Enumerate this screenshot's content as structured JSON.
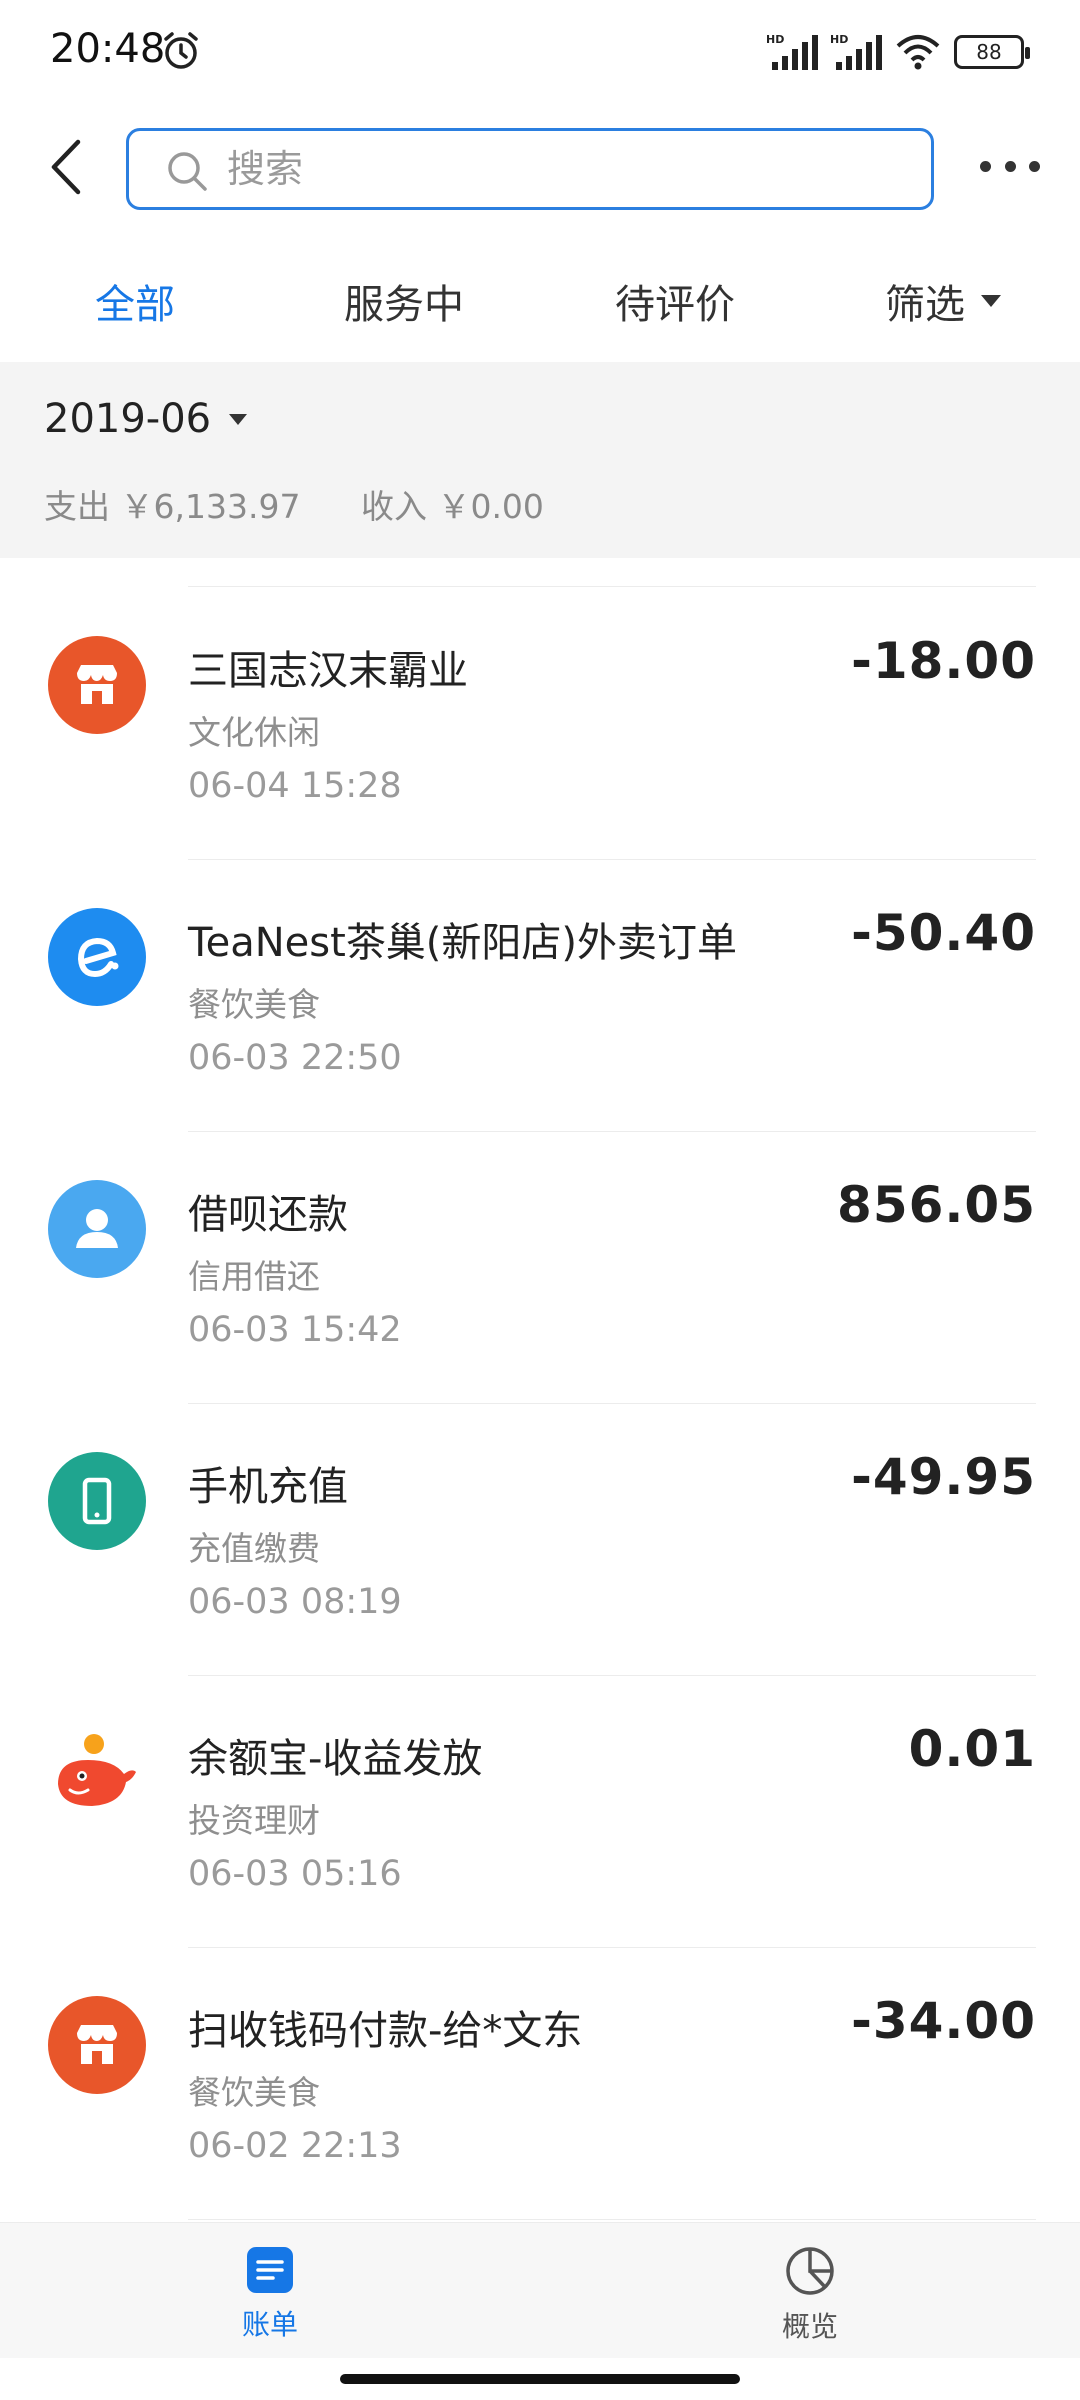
{
  "status_bar": {
    "time": "20:48",
    "network_label": "HD",
    "battery": "88"
  },
  "header": {
    "search_placeholder": "搜索"
  },
  "tabs": [
    {
      "label": "全部",
      "active": true
    },
    {
      "label": "服务中",
      "active": false
    },
    {
      "label": "待评价",
      "active": false
    },
    {
      "label": "筛选",
      "active": false
    }
  ],
  "month": {
    "label": "2019-06",
    "expense": "支出 ￥6,133.97",
    "income": "收入 ￥0.00"
  },
  "transactions": [
    {
      "title": "三国志汉末霸业",
      "category": "文化休闲",
      "time": "06-04  15:28",
      "amount": "-18.00",
      "icon": "store-icon",
      "icon_color": "#e8562a"
    },
    {
      "title": "TeaNest茶巢(新阳店)外卖订单",
      "category": "餐饮美食",
      "time": "06-03  22:50",
      "amount": "-50.40",
      "icon": "eleme-icon",
      "icon_color": "#1e8cf0"
    },
    {
      "title": "借呗还款",
      "category": "信用借还",
      "time": "06-03  15:42",
      "amount": "856.05",
      "icon": "person-icon",
      "icon_color": "#4aa8f0"
    },
    {
      "title": "手机充值",
      "category": "充值缴费",
      "time": "06-03  08:19",
      "amount": "-49.95",
      "icon": "phone-icon",
      "icon_color": "#1fa58f"
    },
    {
      "title": "余额宝-收益发放",
      "category": "投资理财",
      "time": "06-03  05:16",
      "amount": "0.01",
      "icon": "yuebao-icon",
      "icon_color": "#f0492f"
    },
    {
      "title": "扫收钱码付款-给*文东",
      "category": "餐饮美食",
      "time": "06-02  22:13",
      "amount": "-34.00",
      "icon": "store-icon",
      "icon_color": "#e8562a"
    }
  ],
  "bottom_nav": [
    {
      "label": "账单",
      "active": true,
      "icon": "bill-icon"
    },
    {
      "label": "概览",
      "active": false,
      "icon": "pie-chart-icon"
    }
  ],
  "colors": {
    "accent": "#1677e6",
    "search_border": "#2b7fe0"
  }
}
